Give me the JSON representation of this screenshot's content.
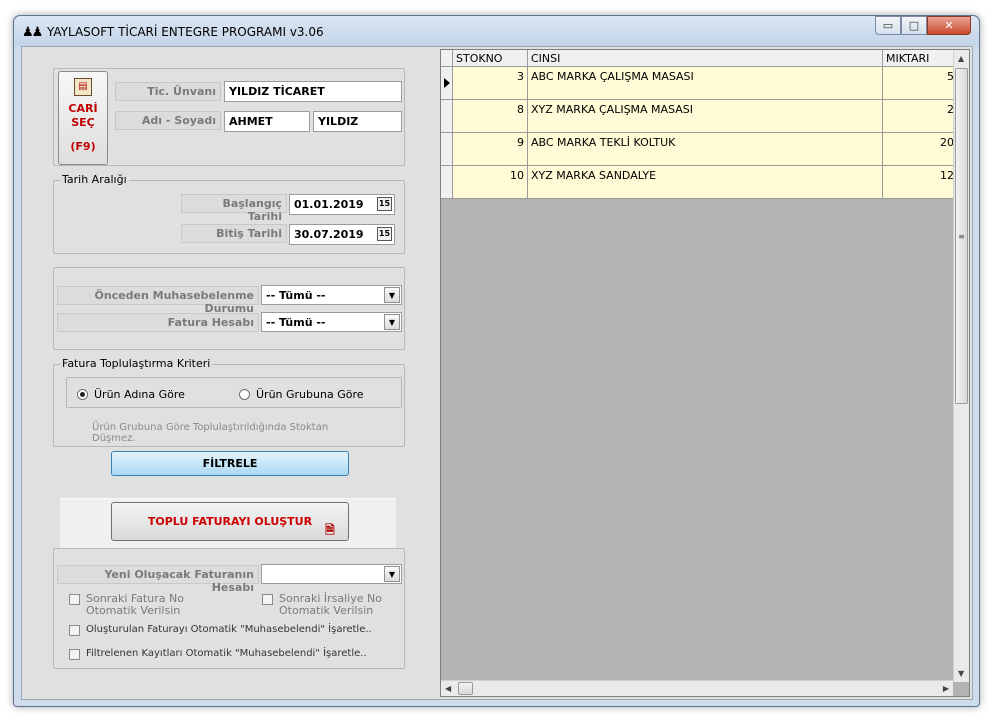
{
  "window": {
    "title": "YAYLASOFT TİCARİ ENTEGRE PROGRAMI v3.06",
    "app_icon": "people-icon",
    "controls": {
      "minimize": "▭",
      "maximize": "□",
      "close": "✕"
    }
  },
  "cari": {
    "button_lines": [
      "CARİ",
      "SEÇ",
      "(F9)"
    ],
    "unvan_label": "Tic. Ünvanı",
    "unvan_value": "YILDIZ TİCARET",
    "adsoyad_label": "Adı - Soyadı",
    "ad_value": "AHMET",
    "soyad_value": "YILDIZ"
  },
  "tarih": {
    "legend": "Tarih Aralığı",
    "baslangic_label": "Başlangıç Tarihi",
    "baslangic_value": "01.01.2019",
    "bitis_label": "Bitiş Tarihi",
    "bitis_value": "30.07.2019",
    "calendar_glyph": "15"
  },
  "filters": {
    "muhasebe_label": "Önceden Muhasebelenme Durumu",
    "muhasebe_value": "-- Tümü --",
    "fatura_label": "Fatura Hesabı",
    "fatura_value": "-- Tümü --"
  },
  "kriter": {
    "legend": "Fatura Toplulaştırma Kriteri",
    "option1": "Ürün Adına Göre",
    "option2": "Ürün Grubuna Göre",
    "selected": 1,
    "note": "Ürün Grubuna Göre Toplulaştırıldığında Stoktan Düşmez."
  },
  "buttons": {
    "filtrele": "FİLTRELE",
    "toplu": "TOPLU FATURAYI OLUŞTUR"
  },
  "yeni": {
    "hesap_label": "Yeni Oluşacak Faturanın Hesabı",
    "hesap_value": "",
    "chk_fatura_no": "Sonraki Fatura No Otomatik Verilsin",
    "chk_irsaliye_no": "Sonraki İrsaliye No Otomatik Verilsin",
    "chk_olusturulan": "Oluşturulan Faturayı Otomatik \"Muhasebelendi\" İşaretle..",
    "chk_filtrelenen": "Filtrelenen Kayıtları Otomatik \"Muhasebelendi\" İşaretle.."
  },
  "grid": {
    "columns": [
      "STOKNO",
      "CINSI",
      "MIKTARI"
    ],
    "rows": [
      {
        "stokno": "3",
        "cinsi": "ABC MARKA ÇALIŞMA MASASI",
        "miktari": "5"
      },
      {
        "stokno": "8",
        "cinsi": "XYZ MARKA ÇALIŞMA MASASI",
        "miktari": "2"
      },
      {
        "stokno": "9",
        "cinsi": "ABC MARKA TEKLİ KOLTUK",
        "miktari": "20"
      },
      {
        "stokno": "10",
        "cinsi": "XYZ MARKA SANDALYE",
        "miktari": "12"
      }
    ],
    "active_row": 0
  },
  "colors": {
    "row_bg": "#fffbd7",
    "accent_red": "#cc0000",
    "filter_button": "#a9d9f3"
  }
}
